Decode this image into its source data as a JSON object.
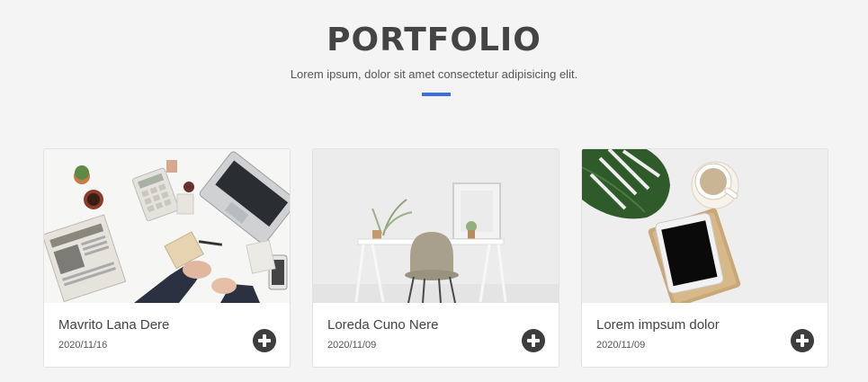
{
  "section": {
    "title": "PORTFOLIO",
    "subtitle": "Lorem ipsum, dolor sit amet consectetur adipisicing elit.",
    "accent_color": "#3b6fe0"
  },
  "cards": [
    {
      "title": "Mavrito Lana Dere",
      "date": "2020/11/16",
      "image": "office-desk-workspace-photo",
      "action_icon": "plus-circle-icon"
    },
    {
      "title": "Loreda Cuno Nere",
      "date": "2020/11/09",
      "image": "white-desk-chair-photo",
      "action_icon": "plus-circle-icon"
    },
    {
      "title": "Lorem impsum dolor",
      "date": "2020/11/09",
      "image": "tablet-coffee-plant-photo",
      "action_icon": "plus-circle-icon"
    }
  ]
}
